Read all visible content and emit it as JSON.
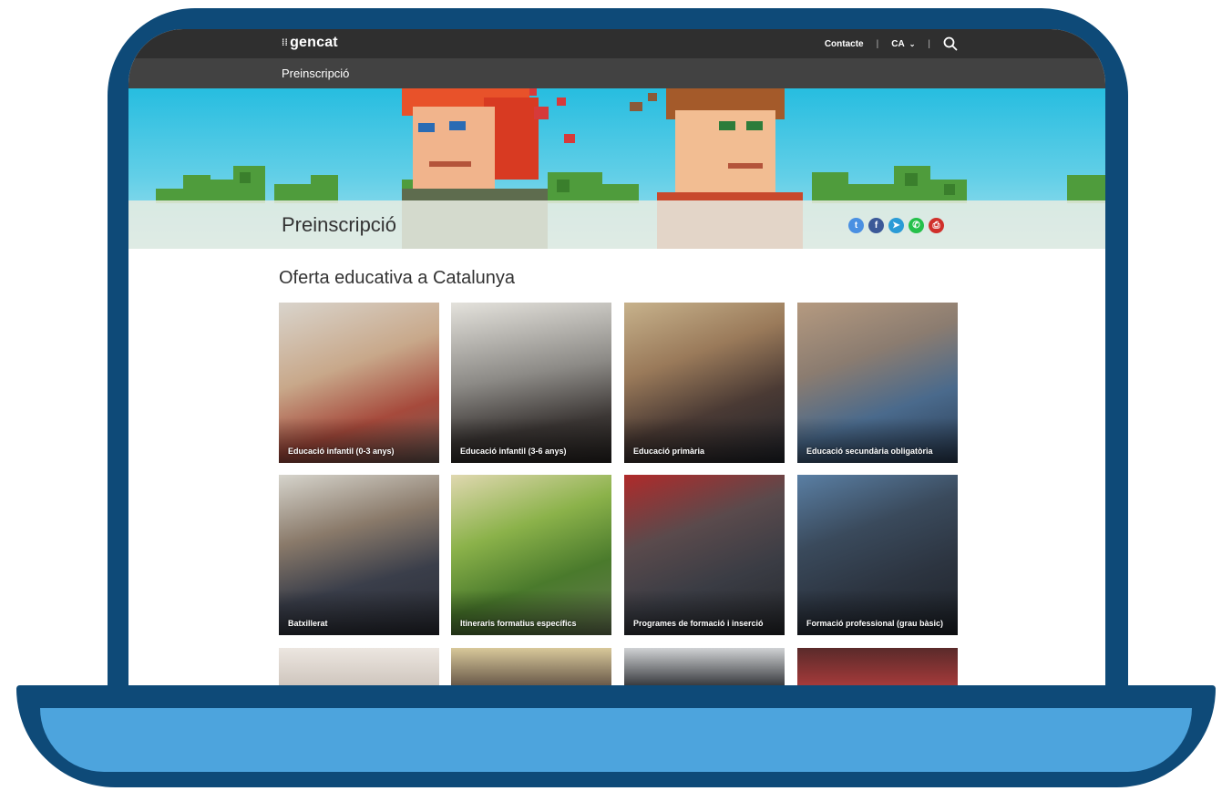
{
  "header": {
    "logo_text": "gencat",
    "logo_mark": "⁞⁞",
    "contact_label": "Contacte",
    "separator": "|",
    "language_label": "CA",
    "search_icon": "search-icon"
  },
  "subheader": {
    "title": "Preinscripció"
  },
  "hero": {
    "title": "Preinscripció",
    "share": [
      {
        "icon": "twitter-icon",
        "glyph": "t",
        "color": "#4a90e2"
      },
      {
        "icon": "facebook-icon",
        "glyph": "f",
        "color": "#3b5998"
      },
      {
        "icon": "telegram-icon",
        "glyph": "➤",
        "color": "#2a9bd6"
      },
      {
        "icon": "whatsapp-icon",
        "glyph": "✆",
        "color": "#25c04a"
      },
      {
        "icon": "print-icon",
        "glyph": "⎙",
        "color": "#d0302b"
      }
    ]
  },
  "section": {
    "title": "Oferta educativa a Catalunya"
  },
  "cards": [
    {
      "label": "Educació infantil (0-3 anys)"
    },
    {
      "label": "Educació infantil (3-6 anys)"
    },
    {
      "label": "Educació primària"
    },
    {
      "label": "Educació secundària obligatòria"
    },
    {
      "label": "Batxillerat"
    },
    {
      "label": "Itineraris formatius específics"
    },
    {
      "label": "Programes de formació i inserció"
    },
    {
      "label": "Formació professional (grau bàsic)"
    },
    {
      "label": ""
    },
    {
      "label": ""
    },
    {
      "label": ""
    },
    {
      "label": ""
    }
  ],
  "colors": {
    "laptop_frame": "#0e4a78",
    "laptop_base": "#4da4dd",
    "topbar": "#2f2f2f",
    "subbar": "#424242"
  }
}
